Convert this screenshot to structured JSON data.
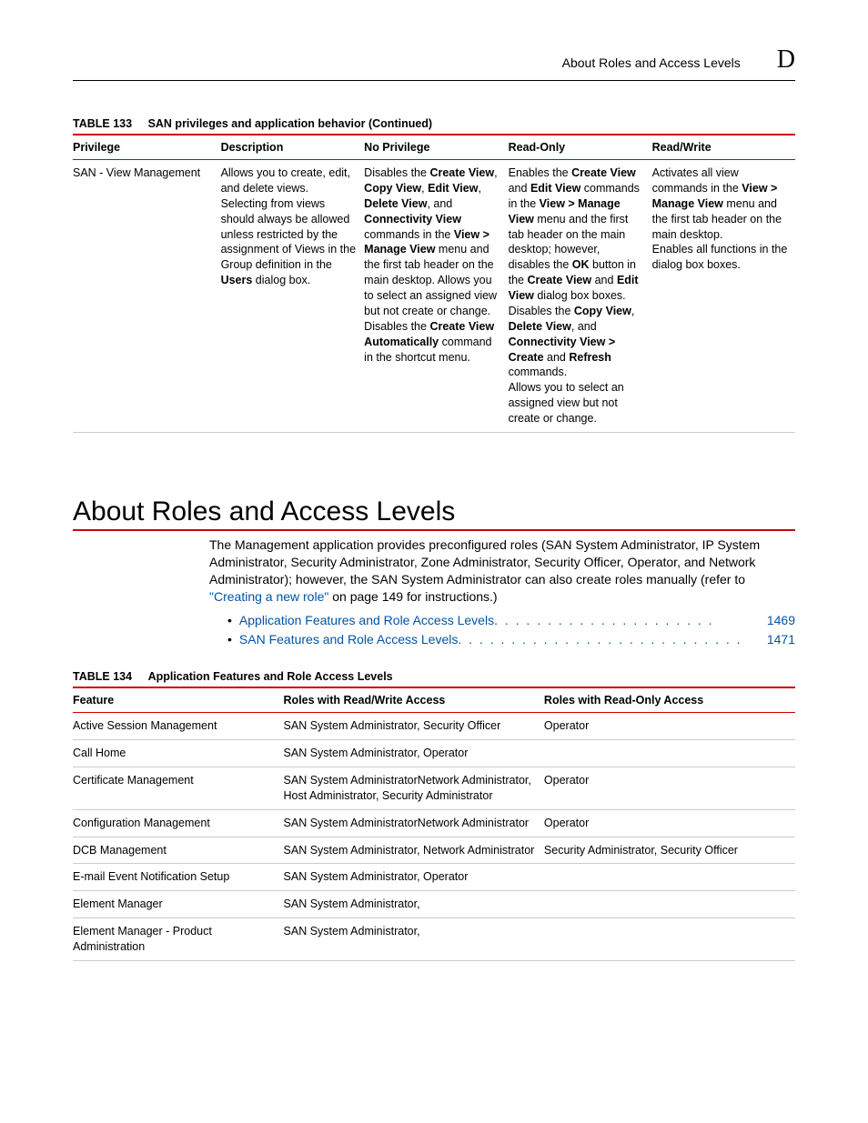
{
  "header": {
    "title": "About Roles and Access Levels",
    "letter": "D"
  },
  "table133": {
    "label": "TABLE 133",
    "title": "SAN privileges and application behavior (Continued)",
    "headers": [
      "Privilege",
      "Description",
      "No Privilege",
      "Read-Only",
      "Read/Write"
    ],
    "row": {
      "privilege": "SAN - View Management",
      "desc": {
        "p1a": "Allows you to create, edit, and delete views.",
        "p1b": "Selecting from views should always be allowed unless restricted by the assignment of Views in the Group definition in the ",
        "p1c": "Users",
        "p1d": " dialog box."
      },
      "nopriv": {
        "a": "Disables the ",
        "b": "Create View",
        "c": ", ",
        "d": "Copy View",
        "e": ", ",
        "f": "Edit View",
        "g": ", ",
        "h": "Delete View",
        "i": ", and ",
        "j": "Connectivity View",
        "k": " commands in the ",
        "l": "View > Manage View",
        "m": " menu and the first tab header on the main desktop. Allows you to select an assigned view but not create or change.",
        "p2a": "Disables the ",
        "p2b": "Create View Automatically",
        "p2c": " command in the shortcut menu."
      },
      "readonly": {
        "a": "Enables the ",
        "b": "Create View",
        "c": " and ",
        "d": "Edit View",
        "e": " commands in the ",
        "f": "View > Manage View",
        "g": " menu and the first tab header on the main desktop; however, disables the ",
        "h": "OK",
        "i": " button in the ",
        "j": "Create View",
        "k": " and ",
        "l": "Edit View",
        "m": " dialog box boxes.",
        "p2a": "Disables the ",
        "p2b": "Copy View",
        "p2c": ", ",
        "p2d": "Delete View",
        "p2e": ", and ",
        "p2f": "Connectivity View > Create",
        "p2g": " and ",
        "p2h": "Refresh",
        "p2i": " commands.",
        "p3": "Allows you to select an assigned view but not create or change."
      },
      "readwrite": {
        "a": "Activates all view commands in the ",
        "b": "View > Manage View",
        "c": " menu and the first tab header on the main desktop.",
        "p2": "Enables all functions in the dialog box boxes."
      }
    }
  },
  "section": {
    "heading": "About Roles and Access Levels",
    "para_a": "The Management application provides preconfigured roles (SAN System Administrator, IP System Administrator, Security Administrator, Zone Administrator, Security Officer, Operator, and Network Administrator); however, the SAN System Administrator  can also create roles manually (refer to ",
    "para_link": "\"Creating a new role\"",
    "para_b": " on page 149 for instructions.)"
  },
  "toc": [
    {
      "label": "Application Features and Role Access Levels",
      "page": "1469"
    },
    {
      "label": "SAN Features and Role Access Levels",
      "page": "1471"
    }
  ],
  "table134": {
    "label": "TABLE 134",
    "title": "Application Features and Role Access Levels",
    "headers": [
      "Feature",
      "Roles with Read/Write Access",
      "Roles with Read-Only Access"
    ],
    "rows": [
      {
        "f": "Active Session Management",
        "rw": "SAN System Administrator, Security Officer",
        "ro": "Operator"
      },
      {
        "f": "Call Home",
        "rw": "SAN System Administrator, Operator",
        "ro": ""
      },
      {
        "f": "Certificate Management",
        "rw": "SAN System AdministratorNetwork Administrator, Host Administrator, Security Administrator",
        "ro": "Operator"
      },
      {
        "f": "Configuration Management",
        "rw": "SAN System AdministratorNetwork Administrator",
        "ro": "Operator"
      },
      {
        "f": "DCB Management",
        "rw": "SAN System Administrator, Network Administrator",
        "ro": "Security Administrator, Security Officer"
      },
      {
        "f": "E-mail Event Notification Setup",
        "rw": "SAN System Administrator, Operator",
        "ro": ""
      },
      {
        "f": "Element Manager",
        "rw": "SAN System Administrator,",
        "ro": ""
      },
      {
        "f": "Element Manager - Product Administration",
        "rw": "SAN System Administrator,",
        "ro": ""
      }
    ]
  }
}
